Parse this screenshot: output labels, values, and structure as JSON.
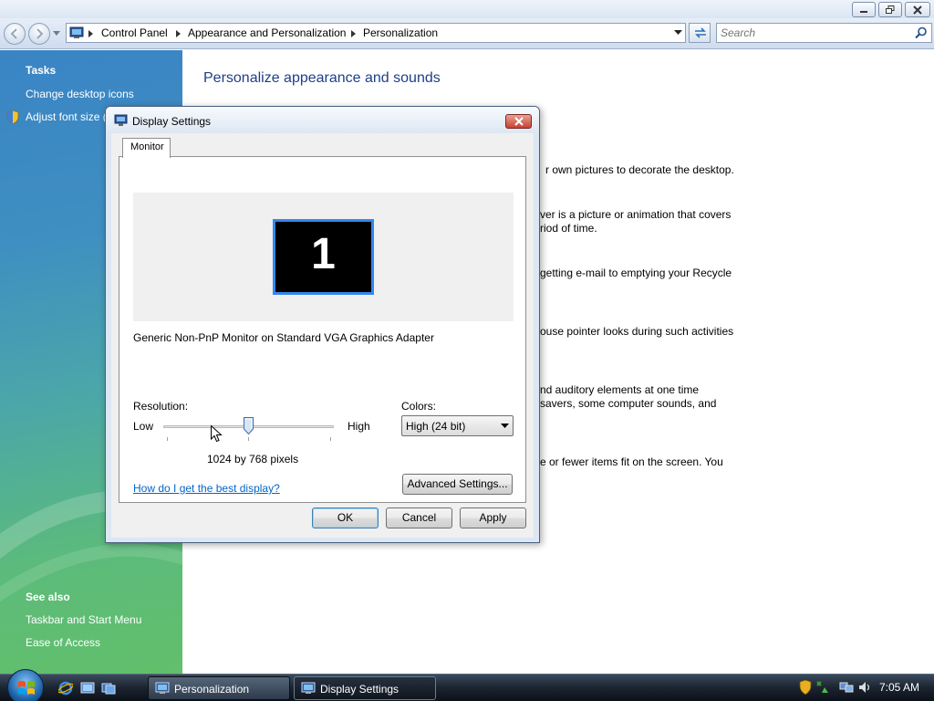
{
  "explorer": {
    "breadcrumbs": [
      "Control Panel",
      "Appearance and Personalization",
      "Personalization"
    ],
    "search_placeholder": "Search"
  },
  "sidebar": {
    "tasks_heading": "Tasks",
    "tasks": [
      "Change desktop icons",
      "Adjust font size ("
    ],
    "see_also_heading": "See also",
    "see_also": [
      "Taskbar and Start Menu",
      "Ease of Access"
    ]
  },
  "main": {
    "title": "Personalize appearance and sounds",
    "desc_1": "r own pictures to decorate the desktop.",
    "desc_2a": "ver is a picture or animation that covers",
    "desc_2b": "riod of time.",
    "desc_3": "getting e-mail to emptying your Recycle",
    "desc_4": "ouse pointer looks during such activities",
    "desc_5a": "nd auditory elements at one time",
    "desc_5b": " savers, some computer sounds, and",
    "desc_6": "e or fewer items fit on the screen. You"
  },
  "dialog": {
    "title": "Display Settings",
    "tab_label": "Monitor",
    "monitor_number": "1",
    "monitor_name": "Generic Non-PnP Monitor on Standard VGA Graphics Adapter",
    "resolution_label": "Resolution:",
    "low_label": "Low",
    "high_label": "High",
    "resolution_value": "1024 by 768 pixels",
    "resolution_slider_fraction": 0.5,
    "colors_label": "Colors:",
    "colors_selected": "High (24 bit)",
    "help_link": "How do I get the best display?",
    "advanced_button": "Advanced Settings...",
    "ok_button": "OK",
    "cancel_button": "Cancel",
    "apply_button": "Apply"
  },
  "taskbar": {
    "buttons": [
      "Personalization",
      "Display Settings"
    ],
    "active_button": "Display Settings",
    "clock": "7:05 AM"
  },
  "colors": {
    "link_blue": "#0066cc",
    "title_blue": "#1e3f87",
    "monitor_border": "#3388ee"
  }
}
